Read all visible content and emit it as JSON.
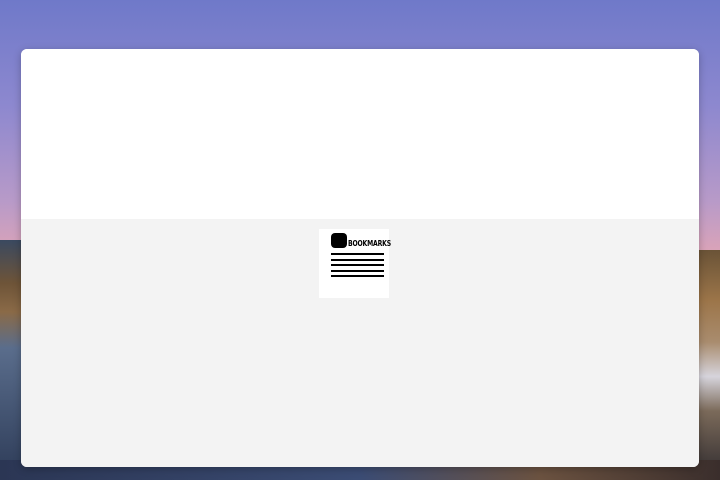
{
  "desktop": {
    "wallpaper": "mountain-lake-dusk"
  },
  "window": {
    "top_pane_color": "#ffffff",
    "content_bg_color": "#f3f3f3"
  },
  "bookmarks_tile": {
    "label": "BOOKMARKS",
    "icon": "bookmarks-icon",
    "line_count": 5
  }
}
